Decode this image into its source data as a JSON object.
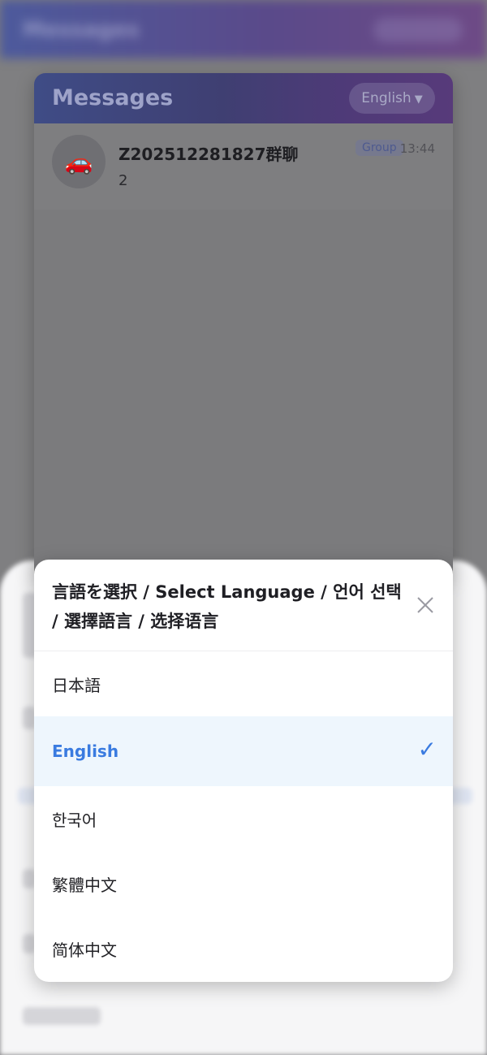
{
  "background": {
    "header_title": "Messages"
  },
  "card": {
    "title": "Messages",
    "language_button": "English",
    "caret": "▼",
    "conversation": {
      "avatar": "🚗",
      "name": "Z202512281827群聊",
      "badge": "Group",
      "time": "13:44",
      "preview": "2"
    }
  },
  "modal": {
    "title": "言語を選択 / Select Language / 언어 선택 / 選擇語言 / 选择语言",
    "options": [
      {
        "label": "日本語",
        "selected": false
      },
      {
        "label": "English",
        "selected": true
      },
      {
        "label": "한국어",
        "selected": false
      },
      {
        "label": "繁體中文",
        "selected": false
      },
      {
        "label": "简体中文",
        "selected": false
      }
    ],
    "check_mark": "✓"
  },
  "colors": {
    "accent": "#3a7be0",
    "selected_bg": "#eef6fd"
  }
}
